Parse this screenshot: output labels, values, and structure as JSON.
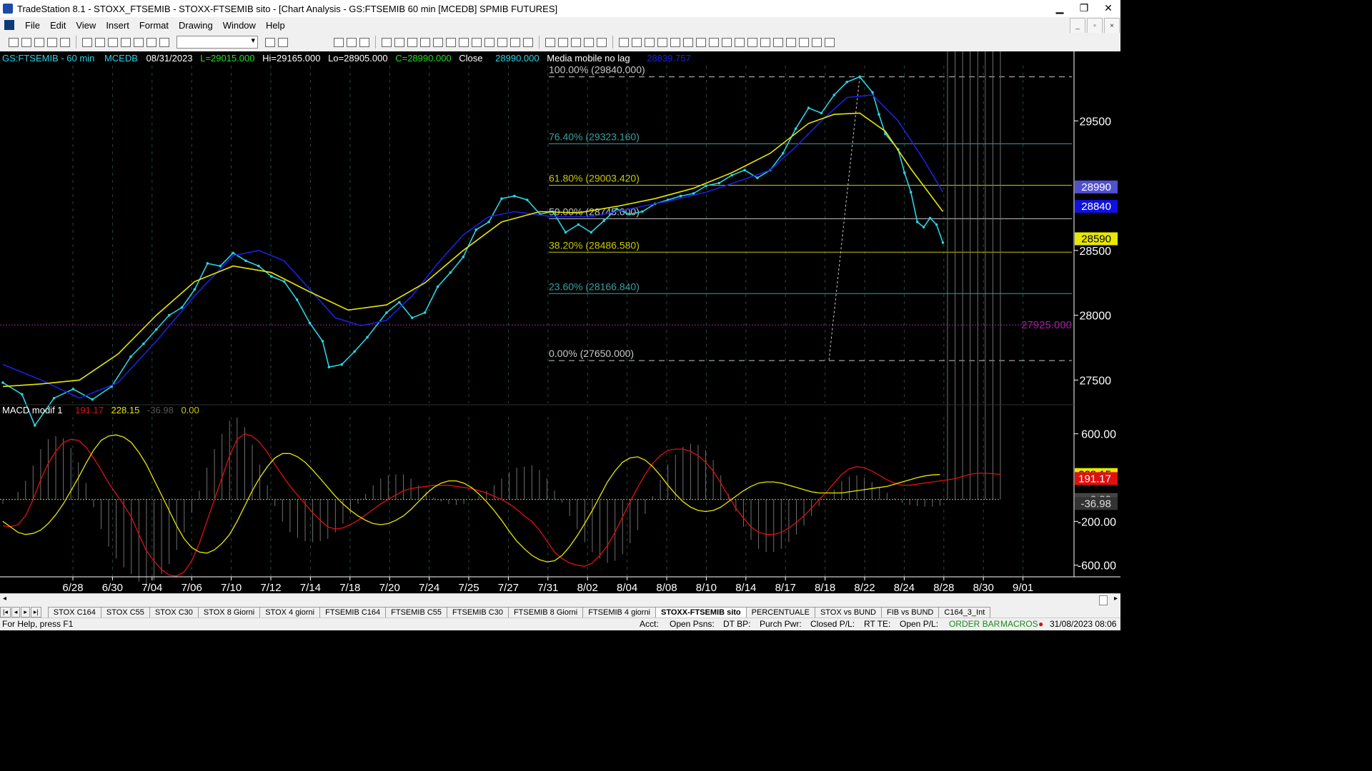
{
  "window": {
    "title": "TradeStation 8.1 - STOXX_FTSEMIB - STOXX-FTSEMIB sito - [Chart Analysis - GS:FTSEMIB  60 min  [MCEDB] SPMIB FUTURES]",
    "minimize": "▁",
    "maximize": "❐",
    "close": "✕"
  },
  "menu": [
    "File",
    "Edit",
    "View",
    "Insert",
    "Format",
    "Drawing",
    "Window",
    "Help"
  ],
  "mdi": {
    "minimize": "_",
    "restore": "▫",
    "close": "×"
  },
  "header": {
    "symbol": "GS:FTSEMIB - 60 min",
    "exchange": "MCEDB",
    "date": "08/31/2023",
    "last": "L=29015.000",
    "high": "Hi=29165.000",
    "low": "Lo=28905.000",
    "close": "C=28990.000",
    "close_label": "Close",
    "close_value": "28990.000",
    "ma_label": "Media mobile no lag",
    "ma_value": "28839.757"
  },
  "colors": {
    "price": "#2ad4e6",
    "ma_blue": "#1a22e0",
    "ma_yellow": "#e8e800",
    "fib": "#e0e060",
    "fib_text_cyan": "#3aa0a0",
    "macd_red": "#e01010",
    "macd_yellow": "#e8e800",
    "histogram": "#707070",
    "support": "#a020a0",
    "axis_text": "#ffffff"
  },
  "fib_levels": [
    {
      "label": "100.00% (29840.000)",
      "value": 29840,
      "color": "#c8c8c8"
    },
    {
      "label": "76.40% (29323.160)",
      "value": 29323.16,
      "color": "#3aa0a0"
    },
    {
      "label": "61.80% (29003.420)",
      "value": 29003.42,
      "color": "#c8c800"
    },
    {
      "label": "50.00% (28745.000)",
      "value": 28745,
      "color": "#c8c8c8"
    },
    {
      "label": "38.20% (28486.580)",
      "value": 28486.58,
      "color": "#c8c800"
    },
    {
      "label": "23.60% (28166.840)",
      "value": 28166.84,
      "color": "#3aa0a0"
    },
    {
      "label": "0.00% (27650.000)",
      "value": 27650,
      "color": "#c8c8c8"
    }
  ],
  "support_line": {
    "label": "27925.000",
    "value": 27925
  },
  "price_badges": [
    {
      "text": "28990",
      "bg": "#5050d0",
      "fg": "#ffffff",
      "value": 28990
    },
    {
      "text": "28840",
      "bg": "#1010e0",
      "fg": "#ffffff",
      "value": 28840
    },
    {
      "text": "28590",
      "bg": "#e8e800",
      "fg": "#000000",
      "value": 28590
    }
  ],
  "macd": {
    "name": "MACD modif 1",
    "v1": "191.17",
    "v2": "228.15",
    "v3": "-36.98",
    "v4": "0.00",
    "badges": [
      {
        "text": "228.15",
        "bg": "#e8e800",
        "fg": "#000000",
        "value": 228.15
      },
      {
        "text": "191.17",
        "bg": "#e01010",
        "fg": "#ffffff",
        "value": 191.17
      },
      {
        "text": "0.00",
        "bg": "#444444",
        "fg": "#cccccc",
        "value": 0
      },
      {
        "text": "-36.98",
        "bg": "#333333",
        "fg": "#dddddd",
        "value": -36.98
      }
    ]
  },
  "chart_data": [
    {
      "type": "line",
      "title": "GS:FTSEMIB - 60 min",
      "x_tick_labels": [
        "6/28",
        "6/30",
        "7/04",
        "7/06",
        "7/10",
        "7/12",
        "7/14",
        "7/18",
        "7/20",
        "7/24",
        "7/25",
        "7/27",
        "7/31",
        "8/02",
        "8/04",
        "8/08",
        "8/10",
        "8/14",
        "8/17",
        "8/18",
        "8/22",
        "8/24",
        "8/28",
        "8/30",
        "9/01"
      ],
      "y_ticks": [
        27500,
        28000,
        28500,
        29500
      ],
      "ylim": [
        27320,
        29970
      ],
      "x_index_range": [
        0,
        156
      ],
      "grid": "vertical dashed at selected dates",
      "series": [
        {
          "name": "GS:FTSEMIB - 60 min",
          "color": "#2ad4e6",
          "points": [
            [
              0,
              27480
            ],
            [
              3,
              27390
            ],
            [
              5,
              27150
            ],
            [
              8,
              27360
            ],
            [
              11,
              27430
            ],
            [
              14,
              27350
            ],
            [
              17,
              27450
            ],
            [
              20,
              27680
            ],
            [
              22,
              27780
            ],
            [
              24,
              27890
            ],
            [
              26,
              28000
            ],
            [
              28,
              28060
            ],
            [
              30,
              28200
            ],
            [
              32,
              28400
            ],
            [
              34,
              28380
            ],
            [
              36,
              28480
            ],
            [
              38,
              28420
            ],
            [
              40,
              28380
            ],
            [
              42,
              28300
            ],
            [
              44,
              28260
            ],
            [
              46,
              28120
            ],
            [
              48,
              27940
            ],
            [
              50,
              27800
            ],
            [
              51,
              27600
            ],
            [
              53,
              27620
            ],
            [
              55,
              27720
            ],
            [
              57,
              27830
            ],
            [
              60,
              28020
            ],
            [
              62,
              28100
            ],
            [
              64,
              27980
            ],
            [
              66,
              28020
            ],
            [
              68,
              28220
            ],
            [
              70,
              28330
            ],
            [
              72,
              28450
            ],
            [
              74,
              28660
            ],
            [
              76,
              28720
            ],
            [
              78,
              28900
            ],
            [
              80,
              28920
            ],
            [
              82,
              28890
            ],
            [
              84,
              28780
            ],
            [
              86,
              28800
            ],
            [
              88,
              28640
            ],
            [
              90,
              28700
            ],
            [
              92,
              28640
            ],
            [
              94,
              28730
            ],
            [
              96,
              28820
            ],
            [
              98,
              28780
            ],
            [
              100,
              28800
            ],
            [
              102,
              28860
            ],
            [
              104,
              28890
            ],
            [
              106,
              28920
            ],
            [
              108,
              28940
            ],
            [
              110,
              29000
            ],
            [
              112,
              29020
            ],
            [
              114,
              29080
            ],
            [
              116,
              29120
            ],
            [
              118,
              29060
            ],
            [
              120,
              29120
            ],
            [
              122,
              29250
            ],
            [
              124,
              29440
            ],
            [
              126,
              29600
            ],
            [
              128,
              29560
            ],
            [
              130,
              29700
            ],
            [
              132,
              29800
            ],
            [
              134,
              29840
            ],
            [
              136,
              29720
            ],
            [
              137,
              29550
            ],
            [
              138,
              29400
            ],
            [
              140,
              29280
            ],
            [
              141,
              29100
            ],
            [
              142,
              28950
            ],
            [
              143,
              28720
            ],
            [
              144,
              28680
            ],
            [
              145,
              28750
            ],
            [
              146,
              28700
            ],
            [
              147,
              28560
            ]
          ]
        },
        {
          "name": "blue moving average",
          "color": "#1a22e0",
          "points": [
            [
              0,
              27620
            ],
            [
              6,
              27500
            ],
            [
              12,
              27360
            ],
            [
              18,
              27480
            ],
            [
              24,
              27800
            ],
            [
              30,
              28150
            ],
            [
              36,
              28460
            ],
            [
              40,
              28500
            ],
            [
              44,
              28420
            ],
            [
              48,
              28200
            ],
            [
              52,
              27980
            ],
            [
              56,
              27920
            ],
            [
              60,
              27960
            ],
            [
              64,
              28150
            ],
            [
              68,
              28400
            ],
            [
              72,
              28620
            ],
            [
              76,
              28760
            ],
            [
              80,
              28800
            ],
            [
              86,
              28760
            ],
            [
              92,
              28760
            ],
            [
              98,
              28820
            ],
            [
              104,
              28880
            ],
            [
              110,
              28950
            ],
            [
              116,
              29050
            ],
            [
              120,
              29120
            ],
            [
              124,
              29300
            ],
            [
              128,
              29500
            ],
            [
              132,
              29680
            ],
            [
              136,
              29700
            ],
            [
              140,
              29500
            ],
            [
              144,
              29200
            ],
            [
              147,
              28950
            ]
          ]
        },
        {
          "name": "yellow moving average",
          "color": "#e8e800",
          "points": [
            [
              0,
              27450
            ],
            [
              6,
              27470
            ],
            [
              12,
              27500
            ],
            [
              18,
              27700
            ],
            [
              24,
              28000
            ],
            [
              30,
              28260
            ],
            [
              36,
              28380
            ],
            [
              42,
              28330
            ],
            [
              48,
              28180
            ],
            [
              54,
              28040
            ],
            [
              60,
              28080
            ],
            [
              66,
              28250
            ],
            [
              72,
              28500
            ],
            [
              78,
              28720
            ],
            [
              84,
              28800
            ],
            [
              90,
              28790
            ],
            [
              96,
              28840
            ],
            [
              102,
              28900
            ],
            [
              108,
              28980
            ],
            [
              114,
              29100
            ],
            [
              120,
              29250
            ],
            [
              126,
              29480
            ],
            [
              130,
              29550
            ],
            [
              134,
              29560
            ],
            [
              138,
              29420
            ],
            [
              142,
              29130
            ],
            [
              147,
              28800
            ]
          ]
        }
      ]
    },
    {
      "type": "line",
      "title": "MACD modif 1",
      "y_ticks": [
        -600,
        -200,
        600
      ],
      "ylim": [
        -700,
        800
      ],
      "series": [
        {
          "name": "MACD modif 1",
          "color": "#e01010",
          "values": [
            -240,
            -250,
            -230,
            -150,
            0,
            180,
            330,
            440,
            520,
            550,
            540,
            480,
            380,
            270,
            150,
            50,
            -50,
            -160,
            -320,
            -470,
            -560,
            -640,
            -690,
            -700,
            -660,
            -560,
            -400,
            -200,
            0,
            200,
            400,
            550,
            600,
            580,
            520,
            430,
            320,
            220,
            120,
            40,
            -40,
            -120,
            -190,
            -250,
            -270,
            -260,
            -230,
            -190,
            -140,
            -90,
            -40,
            0,
            40,
            80,
            100,
            110,
            120,
            130,
            130,
            130,
            120,
            110,
            100,
            80,
            60,
            30,
            0,
            -40,
            -90,
            -150,
            -200,
            -280,
            -380,
            -480,
            -540,
            -580,
            -600,
            -610,
            -580,
            -510,
            -420,
            -300,
            -160,
            -20,
            110,
            230,
            330,
            400,
            450,
            460,
            460,
            440,
            400,
            340,
            260,
            150,
            30,
            -80,
            -170,
            -250,
            -300,
            -320,
            -320,
            -300,
            -260,
            -210,
            -150,
            -80,
            0,
            70,
            150,
            230,
            280,
            300,
            290,
            260,
            220,
            180,
            150,
            130,
            130,
            140,
            150,
            160,
            170,
            180,
            190,
            210,
            230,
            240,
            240,
            235,
            230
          ]
        },
        {
          "name": "signal",
          "color": "#e8e800",
          "values": [
            -200,
            -250,
            -300,
            -320,
            -310,
            -280,
            -220,
            -140,
            -40,
            80,
            200,
            330,
            450,
            540,
            580,
            590,
            570,
            520,
            430,
            320,
            180,
            40,
            -100,
            -240,
            -360,
            -440,
            -480,
            -490,
            -460,
            -400,
            -320,
            -200,
            -60,
            80,
            200,
            300,
            380,
            420,
            420,
            390,
            340,
            270,
            190,
            110,
            30,
            -40,
            -100,
            -150,
            -190,
            -220,
            -230,
            -220,
            -190,
            -150,
            -90,
            -20,
            50,
            110,
            150,
            170,
            170,
            150,
            110,
            50,
            -20,
            -100,
            -190,
            -290,
            -380,
            -450,
            -510,
            -550,
            -570,
            -560,
            -510,
            -430,
            -330,
            -220,
            -100,
            30,
            160,
            260,
            340,
            380,
            390,
            360,
            300,
            220,
            130,
            50,
            -20,
            -70,
            -100,
            -110,
            -100,
            -70,
            -20,
            30,
            80,
            120,
            150,
            160,
            160,
            150,
            130,
            110,
            90,
            70,
            60,
            60,
            60,
            60,
            70,
            80,
            90,
            100,
            110,
            120,
            140,
            160,
            180,
            200,
            215,
            225,
            228
          ]
        }
      ]
    }
  ],
  "tabs": [
    "STOX C164",
    "STOX C55",
    "STOX  C30",
    "STOX  8 Giorni",
    "STOX 4 giorni",
    "FTSEMIB C164",
    "FTSEMIB C55",
    "FTSEMIB C30",
    "FTSEMIB  8 Giorni",
    "FTSEMIB  4 giorni",
    "STOXX-FTSEMIB sito",
    "PERCENTUALE",
    "STOX vs BUND",
    "FIB vs BUND",
    "C164_3_Int"
  ],
  "active_tab": "STOXX-FTSEMIB sito",
  "tab_nav": [
    "|◂",
    "◂",
    "▸",
    "▸|"
  ],
  "status": {
    "help": "For Help, press F1",
    "acct": "Acct:",
    "open_psns": "Open Psns:",
    "dt_bp": "DT BP:",
    "purch_pwr": "Purch Pwr:",
    "closed_pl": "Closed P/L:",
    "rt_te": "RT TE:",
    "open_pl": "Open P/L:",
    "order_bar": "ORDER BAR",
    "macros": "MACROS",
    "datetime": "31/08/2023 08:06"
  }
}
